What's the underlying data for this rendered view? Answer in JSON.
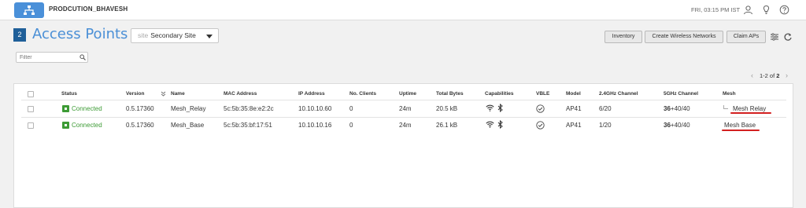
{
  "topbar": {
    "org_name": "PRODCUTION_BHAVESH",
    "clock": "FRI, 03:15 PM IST",
    "icons": [
      "network-logo-icon",
      "user-icon",
      "lightbulb-icon",
      "help-icon"
    ]
  },
  "header": {
    "count": "2",
    "title": "Access Points",
    "site_prefix": "site",
    "site_value": "Secondary Site",
    "buttons": {
      "inventory": "Inventory",
      "create": "Create Wireless Networks",
      "claim": "Claim APs"
    }
  },
  "filter": {
    "placeholder": "Filter"
  },
  "pager": {
    "prev": "‹",
    "range": "1-2 of",
    "total": "2",
    "next": "›"
  },
  "table": {
    "columns": {
      "status": "Status",
      "version": "Version",
      "name": "Name",
      "mac": "MAC Address",
      "ip": "IP Address",
      "clients": "No. Clients",
      "uptime": "Uptime",
      "bytes": "Total Bytes",
      "capabilities": "Capabilities",
      "vble": "VBLE",
      "model": "Model",
      "ch24": "2.4GHz Channel",
      "ch5": "5GHz Channel",
      "mesh": "Mesh"
    },
    "rows": [
      {
        "status": "Connected",
        "version": "0.5.17360",
        "name": "Mesh_Relay",
        "mac": "5c:5b:35:8e:e2:2c",
        "ip": "10.10.10.60",
        "clients": "0",
        "uptime": "24m",
        "bytes": "20.5 kB",
        "model": "AP41",
        "ch24": "6/20",
        "ch5_bold": "36",
        "ch5_rest": "+40/40",
        "mesh": "Mesh Relay"
      },
      {
        "status": "Connected",
        "version": "0.5.17360",
        "name": "Mesh_Base",
        "mac": "5c:5b:35:bf:17:51",
        "ip": "10.10.10.16",
        "clients": "0",
        "uptime": "24m",
        "bytes": "26.1 kB",
        "model": "AP41",
        "ch24": "1/20",
        "ch5_bold": "36",
        "ch5_rest": "+40/40",
        "mesh": "Mesh Base"
      }
    ]
  },
  "colors": {
    "accent": "#4a8fd6",
    "badge": "#1f5f99",
    "status_green": "#3d9b35",
    "annotation_red": "#d32020"
  }
}
